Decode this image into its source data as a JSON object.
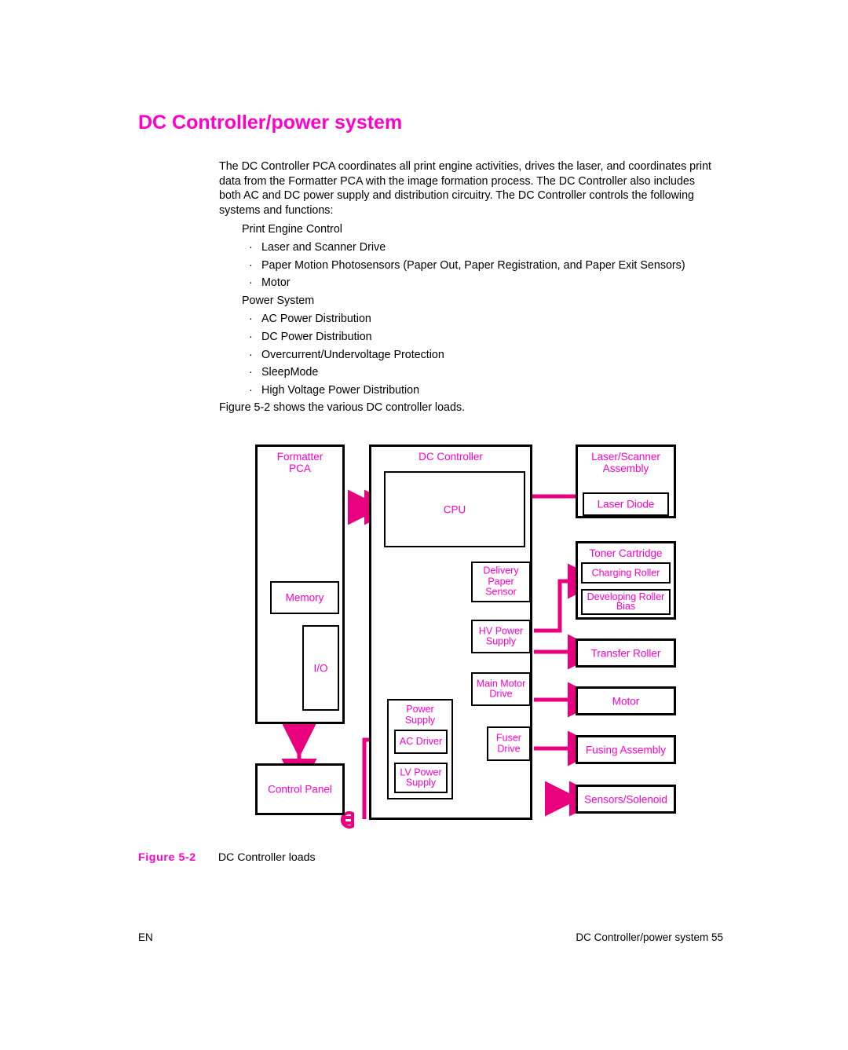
{
  "page": {
    "heading": "DC Controller/power system",
    "intro": "The DC Controller PCA coordinates all print engine activities, drives the laser, and coordinates print data from the Formatter PCA with the image formation process. The DC Controller also includes both AC and DC power supply and distribution circuitry. The DC Controller controls the following systems and functions:",
    "figure_reference": "Figure 5-2 shows the various DC controller loads."
  },
  "list": [
    {
      "type": "plain",
      "text": "Print Engine Control"
    },
    {
      "type": "bullet",
      "text": "Laser and Scanner Drive"
    },
    {
      "type": "bullet",
      "text": "Paper Motion Photosensors (Paper Out, Paper Registration, and Paper Exit Sensors)"
    },
    {
      "type": "bullet",
      "text": "Motor"
    },
    {
      "type": "plain",
      "text": "Power System"
    },
    {
      "type": "bullet",
      "text": "AC Power Distribution"
    },
    {
      "type": "bullet",
      "text": "DC Power Distribution"
    },
    {
      "type": "bullet",
      "text": "Overcurrent/Undervoltage Protection"
    },
    {
      "type": "bullet",
      "text": "SleepMode"
    },
    {
      "type": "bullet",
      "text": "High Voltage Power Distribution"
    }
  ],
  "bullet_glyph": "·",
  "figure": {
    "label": "Figure  5-2",
    "title": "DC Controller loads",
    "blocks": {
      "formatter_pca": "Formatter\nPCA",
      "memory": "Memory",
      "io": "I/O",
      "control_panel": "Control Panel",
      "dc_controller": "DC Controller",
      "cpu": "CPU",
      "delivery_paper_sensor": "Delivery\nPaper\nSensor",
      "hv_power_supply": "HV Power\nSupply",
      "main_motor_drive": "Main Motor\nDrive",
      "power_supply": "Power\nSupply",
      "ac_driver": "AC Driver",
      "lv_power_supply": "LV Power\nSupply",
      "fuser_drive": "Fuser\nDrive",
      "laser_scanner_assembly": "Laser/Scanner\nAssembly",
      "laser_diode": "Laser Diode",
      "toner_cartridge": "Toner Cartridge",
      "charging_roller": "Charging Roller",
      "developing_roller_bias": "Developing Roller\nBias",
      "transfer_roller": "Transfer Roller",
      "motor": "Motor",
      "fusing_assembly": "Fusing Assembly",
      "sensors_solenoid": "Sensors/Solenoid"
    }
  },
  "footer": {
    "left": "EN",
    "right": "DC Controller/power system  55"
  },
  "colors": {
    "accent": "#ff00cc",
    "wire": "#e8007f",
    "outline": "#000000",
    "text": "#000000"
  }
}
